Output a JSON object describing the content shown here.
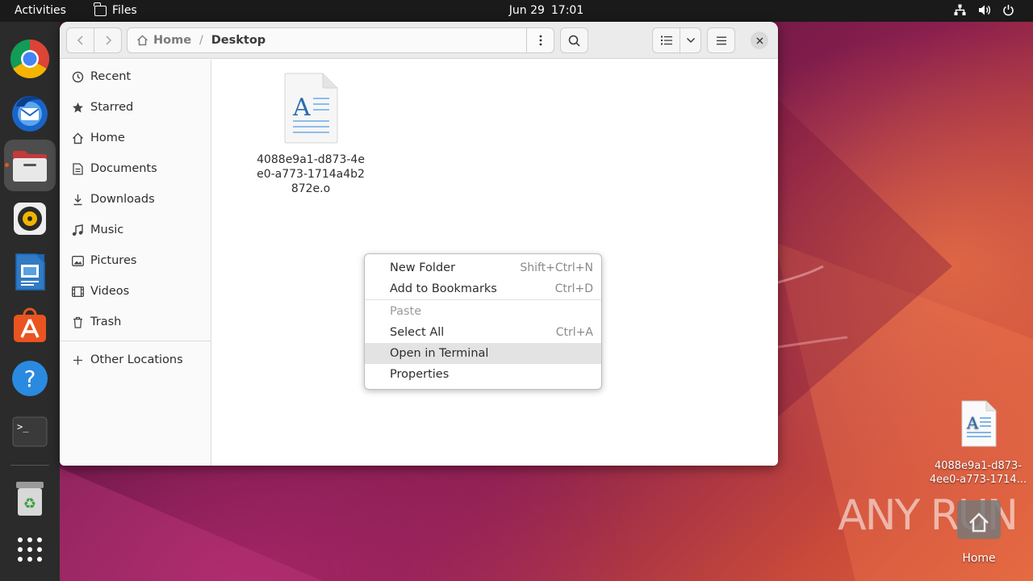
{
  "topbar": {
    "activities": "Activities",
    "app_name": "Files",
    "date": "Jun 29",
    "time": "17:01",
    "tray_icons": [
      "network-icon",
      "volume-icon",
      "power-icon"
    ]
  },
  "dock": {
    "apps": [
      "Google Chrome",
      "Thunderbird",
      "Files",
      "Rhythmbox",
      "LibreOffice Writer",
      "Ubuntu Software",
      "Help",
      "Terminal",
      "Trash",
      "Show Applications"
    ]
  },
  "window": {
    "path": {
      "home": "Home",
      "separator": "/",
      "current": "Desktop"
    },
    "sidebar": {
      "items": [
        {
          "label": "Recent",
          "icon": "clock-icon"
        },
        {
          "label": "Starred",
          "icon": "star-icon"
        },
        {
          "label": "Home",
          "icon": "home-icon"
        },
        {
          "label": "Documents",
          "icon": "document-icon"
        },
        {
          "label": "Downloads",
          "icon": "download-icon"
        },
        {
          "label": "Music",
          "icon": "music-icon"
        },
        {
          "label": "Pictures",
          "icon": "picture-icon"
        },
        {
          "label": "Videos",
          "icon": "video-icon"
        },
        {
          "label": "Trash",
          "icon": "trash-icon"
        }
      ],
      "other": {
        "label": "Other Locations",
        "icon": "plus-icon"
      }
    },
    "files": [
      {
        "name": "4088e9a1-d873-4ee0-a773-1714a4b2872e.o",
        "icon": "text-document-icon"
      }
    ]
  },
  "context_menu": {
    "items": [
      {
        "label": "New Folder",
        "accel": "Shift+Ctrl+N"
      },
      {
        "label": "Add to Bookmarks",
        "accel": "Ctrl+D"
      },
      {
        "label": "Paste",
        "accel": ""
      },
      {
        "label": "Select All",
        "accel": "Ctrl+A"
      },
      {
        "label": "Open in Terminal",
        "accel": ""
      },
      {
        "label": "Properties",
        "accel": ""
      }
    ]
  },
  "desktop": {
    "file_label_line1": "4088e9a1-d873-",
    "file_label_line2": "4ee0-a773-1714...",
    "home_label": "Home",
    "watermark": "ANY RUN"
  },
  "colors": {
    "accent": "#e95420",
    "dock": "#2b2b2b",
    "topbar": "#1a1a1a"
  }
}
